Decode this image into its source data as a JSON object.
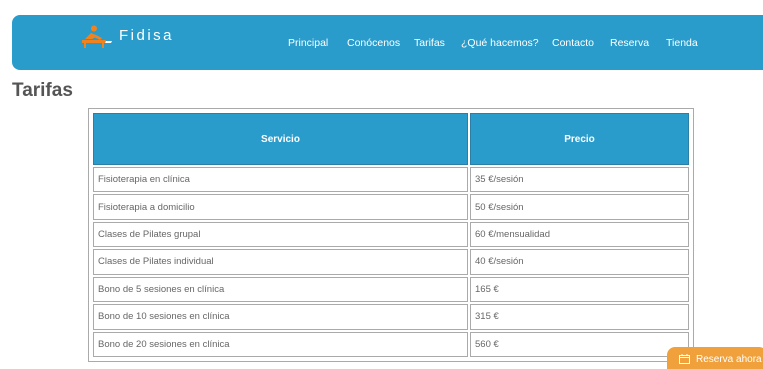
{
  "brand": {
    "name": "Fidisa"
  },
  "nav": [
    {
      "label": "Principal"
    },
    {
      "label": "Conócenos"
    },
    {
      "label": "Tarifas"
    },
    {
      "label": "¿Qué hacemos?"
    },
    {
      "label": "Contacto"
    },
    {
      "label": "Reserva"
    },
    {
      "label": "Tienda"
    }
  ],
  "page": {
    "title": "Tarifas"
  },
  "table": {
    "headers": [
      "Servicio",
      "Precio"
    ],
    "rows": [
      [
        "Fisioterapia en clínica",
        "35 €/sesión"
      ],
      [
        "Fisioterapia a domicilio",
        "50 €/sesión"
      ],
      [
        "Clases de Pilates grupal",
        "60 €/mensualidad"
      ],
      [
        "Clases de Pilates individual",
        "40 €/sesión"
      ],
      [
        "Bono de 5 sesiones en clínica",
        "165 €"
      ],
      [
        "Bono de 10 sesiones en clínica",
        "315 €"
      ],
      [
        "Bono de 20 sesiones en clínica",
        "560 €"
      ]
    ]
  },
  "booking": {
    "label": "Reserva ahora"
  },
  "colors": {
    "primary": "#2a9ccc",
    "accent": "#f0a13c",
    "logo_orange": "#f0831e"
  }
}
